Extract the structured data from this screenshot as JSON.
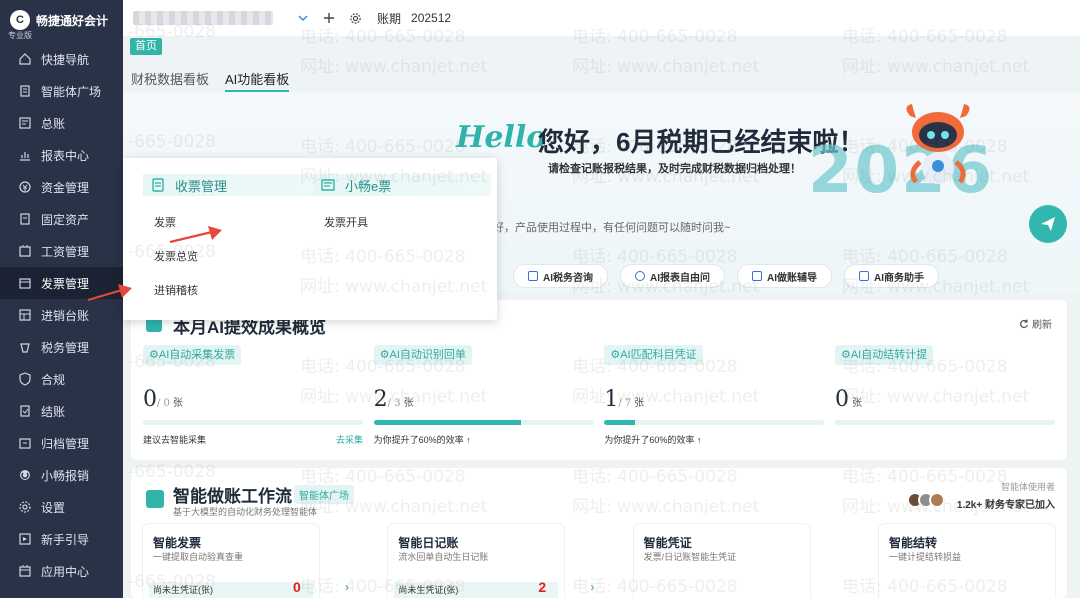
{
  "brand": {
    "name": "畅捷通好会计",
    "edition": "专业版",
    "logo_letter": "C"
  },
  "sidebar": {
    "items": [
      {
        "label": "快捷导航",
        "icon": "home-icon"
      },
      {
        "label": "智能体广场",
        "icon": "building-icon"
      },
      {
        "label": "总账",
        "icon": "ledger-icon"
      },
      {
        "label": "报表中心",
        "icon": "chart-icon"
      },
      {
        "label": "资金管理",
        "icon": "money-icon"
      },
      {
        "label": "固定资产",
        "icon": "asset-icon"
      },
      {
        "label": "工资管理",
        "icon": "salary-icon"
      },
      {
        "label": "发票管理",
        "icon": "invoice-icon",
        "active": true
      },
      {
        "label": "进销台账",
        "icon": "inventory-icon"
      },
      {
        "label": "税务管理",
        "icon": "tax-icon"
      },
      {
        "label": "合规",
        "icon": "shield-icon"
      },
      {
        "label": "结账",
        "icon": "close-book-icon"
      },
      {
        "label": "归档管理",
        "icon": "archive-icon"
      },
      {
        "label": "小畅报销",
        "icon": "reimburse-icon"
      },
      {
        "label": "设置",
        "icon": "gear-icon"
      },
      {
        "label": "新手引导",
        "icon": "guide-icon"
      },
      {
        "label": "应用中心",
        "icon": "apps-icon"
      }
    ]
  },
  "topbar": {
    "period_label": "账期",
    "period_value": "202512"
  },
  "page_tab": "首页",
  "sub_tabs": [
    {
      "label": "财税数据看板"
    },
    {
      "label": "AI功能看板",
      "active": true
    }
  ],
  "banner": {
    "hello": "Hello",
    "headline": "您好，6月税期已经结束啦！",
    "subheadline": "请检查记账报税结果，及时完成财税数据归档处理！",
    "year": "2026",
    "chat_hint": "好，产品使用过程中，有任何问题可以随时问我~",
    "ai_buttons": [
      "AI税务咨询",
      "AI报表自由问",
      "AI做账辅导",
      "AI商务助手"
    ]
  },
  "popup": {
    "col1": {
      "title": "收票管理",
      "items": [
        "发票",
        "发票总览",
        "进销稽核"
      ]
    },
    "col2": {
      "title": "小畅e票",
      "items": [
        "发票开具"
      ]
    }
  },
  "overview": {
    "title": "本月AI提效成果概览",
    "refresh": "刷新",
    "metrics": [
      {
        "tag": "AI自动采集发票",
        "value": "0",
        "total": "/ 0",
        "unit": "张",
        "progress": 0,
        "note": "建议去智能采集",
        "link": "去采集"
      },
      {
        "tag": "AI自动识别回单",
        "value": "2",
        "total": "/ 3",
        "unit": "张",
        "progress": 67,
        "note": "为你提升了60%的效率 ↑",
        "link": ""
      },
      {
        "tag": "AI匹配科目凭证",
        "value": "1",
        "total": "/ 7",
        "unit": "张",
        "progress": 14,
        "note": "为你提升了60%的效率 ↑",
        "link": ""
      },
      {
        "tag": "AI自动结转计提",
        "value": "0",
        "total": "",
        "unit": "张",
        "progress": 0,
        "note": "",
        "link": ""
      }
    ]
  },
  "workflow": {
    "title": "智能做账工作流",
    "tag": "智能体广场",
    "subtitle": "基于大模型的自动化财务处理智能体",
    "usage_label": "智能体使用者",
    "usage": "1.2k+ 财务专家已加入",
    "items": [
      {
        "title": "智能发票",
        "desc": "一键提取自动验真查重",
        "row": "尚未生凭证(张)",
        "count": "0"
      },
      {
        "title": "智能日记账",
        "desc": "流水回单自动生日记账",
        "row": "尚未生凭证(张)",
        "count": "2"
      },
      {
        "title": "智能凭证",
        "desc": "发票/日记账智能生凭证",
        "row": "",
        "count": ""
      },
      {
        "title": "智能结转",
        "desc": "一键计提结转损益",
        "row": "",
        "count": ""
      }
    ]
  },
  "watermark": {
    "phone": "电话: 400-665-0028",
    "site": "网址: www.chanjet.net",
    "fragment": "-665-0028"
  },
  "colors": {
    "sidebar": "#2a3247",
    "accent": "#32b4a8",
    "danger": "#e02020"
  }
}
